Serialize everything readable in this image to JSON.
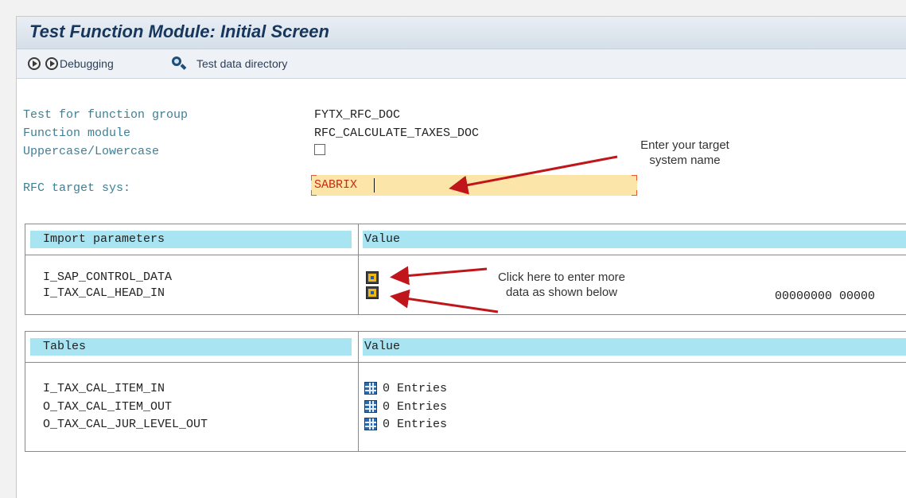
{
  "window": {
    "title": "Test Function Module: Initial Screen"
  },
  "toolbar": {
    "execute_icon": "execute-icon",
    "debug_icon": "execute-icon",
    "debugging_label": "Debugging",
    "test_data_icon": "magnifier-icon",
    "test_data_label": "Test data directory"
  },
  "form": {
    "function_group_label": "Test for function group",
    "function_group_value": "FYTX_RFC_DOC",
    "function_module_label": "Function module",
    "function_module_value": "RFC_CALCULATE_TAXES_DOC",
    "uppercase_label": "Uppercase/Lowercase",
    "uppercase_checked": false,
    "rfc_target_label": "RFC target sys:",
    "rfc_target_value": "SABRIX"
  },
  "import_section": {
    "header_param": "Import parameters",
    "header_value": "Value",
    "rows": [
      {
        "name": "I_SAP_CONTROL_DATA",
        "icon": "structure-edit-icon",
        "value": ""
      },
      {
        "name": "I_TAX_CAL_HEAD_IN",
        "icon": "structure-edit-icon",
        "value": "00000000 00000"
      }
    ]
  },
  "tables_section": {
    "header_param": "Tables",
    "header_value": "Value",
    "rows": [
      {
        "name": "I_TAX_CAL_ITEM_IN",
        "icon": "table-icon",
        "value": "0 Entries"
      },
      {
        "name": "O_TAX_CAL_ITEM_OUT",
        "icon": "table-icon",
        "value": "0 Entries"
      },
      {
        "name": "O_TAX_CAL_JUR_LEVEL_OUT",
        "icon": "table-icon",
        "value": "0 Entries"
      }
    ]
  },
  "annotations": {
    "target_system_line1": "Enter your target",
    "target_system_line2": "system name",
    "click_here_line1": "Click here to enter more",
    "click_here_line2": "data as shown below",
    "arrow_color": "#c0161b"
  },
  "colors": {
    "title_text": "#16365c",
    "label_text": "#3f7f95",
    "header_bg": "#a8e4f2",
    "input_bg": "#fce5a8",
    "input_text": "#cc2b14"
  }
}
